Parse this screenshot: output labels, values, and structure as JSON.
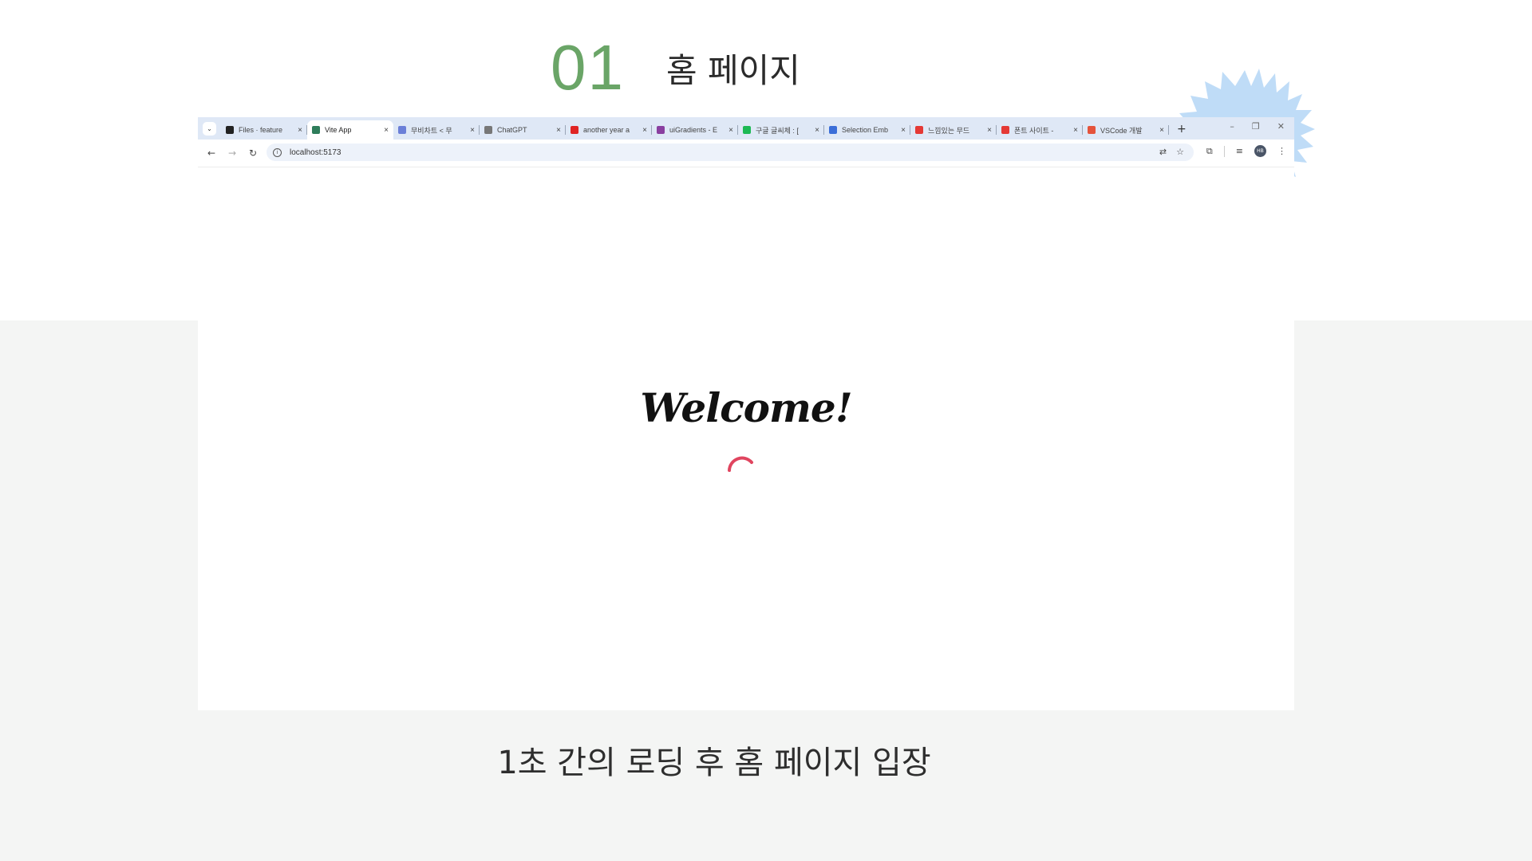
{
  "section": {
    "number": "01",
    "title": "홈 페이지"
  },
  "browser": {
    "tab_search_icon": "chevron-down",
    "tabs": [
      {
        "label": "Files · feature",
        "favicon_color": "#222222"
      },
      {
        "label": "Vite App",
        "favicon_color": "#2e7d5b",
        "active": true
      },
      {
        "label": "무비차트 < 무",
        "favicon_color": "#6b7fd8"
      },
      {
        "label": "ChatGPT",
        "favicon_color": "#777777"
      },
      {
        "label": "another year a",
        "favicon_color": "#e02424"
      },
      {
        "label": "uiGradients - E",
        "favicon_color": "#8a3fa0"
      },
      {
        "label": "구글 글씨체 : [",
        "favicon_color": "#1db954"
      },
      {
        "label": "Selection Emb",
        "favicon_color": "#3b6ed8"
      },
      {
        "label": "느낌있는 무드",
        "favicon_color": "#e53935"
      },
      {
        "label": "폰트 사이트 -",
        "favicon_color": "#e53935"
      },
      {
        "label": "VSCode 개발",
        "favicon_color": "#e5533b"
      }
    ],
    "close_glyph": "×",
    "new_tab": "+",
    "window_controls": {
      "minimize": "–",
      "restore": "❐",
      "close": "✕"
    },
    "nav": {
      "back": "←",
      "forward": "→",
      "reload": "↻"
    },
    "url": "localhost:5173",
    "avatar_initials": "HB"
  },
  "app": {
    "welcome_text": "Welcome!",
    "spinner_color": "#e0455f"
  },
  "caption": "1초 간의 로딩 후 홈 페이지 입장",
  "colors": {
    "accent_green": "#6aa567",
    "burst_blue": "#bfdcf7",
    "band_gray": "#f4f5f4"
  }
}
